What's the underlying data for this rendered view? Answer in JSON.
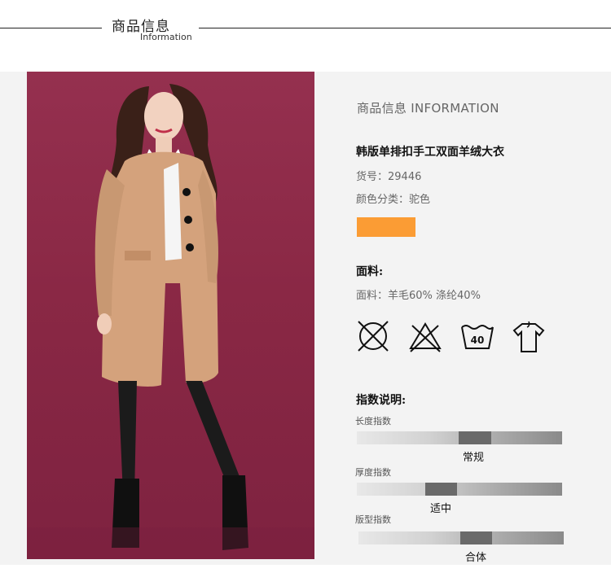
{
  "header": {
    "title": "商品信息",
    "subtitle": "Information"
  },
  "info": {
    "section_title": "商品信息 INFORMATION",
    "product_name": "韩版单排扣手工双面羊绒大衣",
    "sku_label": "货号：29446",
    "color_label": "颜色分类：驼色",
    "swatch_color": "#fb9c34",
    "fabric_heading": "面料:",
    "fabric_text": "面料：羊毛60% 涤纶40%",
    "care_icons": [
      "no-bleach-icon",
      "no-tumble-dry-icon",
      "wash-40-icon",
      "hang-dry-icon"
    ],
    "wash_temp": "40",
    "index_heading": "指数说明:",
    "indices": [
      {
        "label": "长度指数",
        "value": "常规",
        "level": 0.55
      },
      {
        "label": "厚度指数",
        "value": "适中",
        "level": 0.4
      },
      {
        "label": "版型指数",
        "value": "合体",
        "level": 0.55
      }
    ]
  }
}
